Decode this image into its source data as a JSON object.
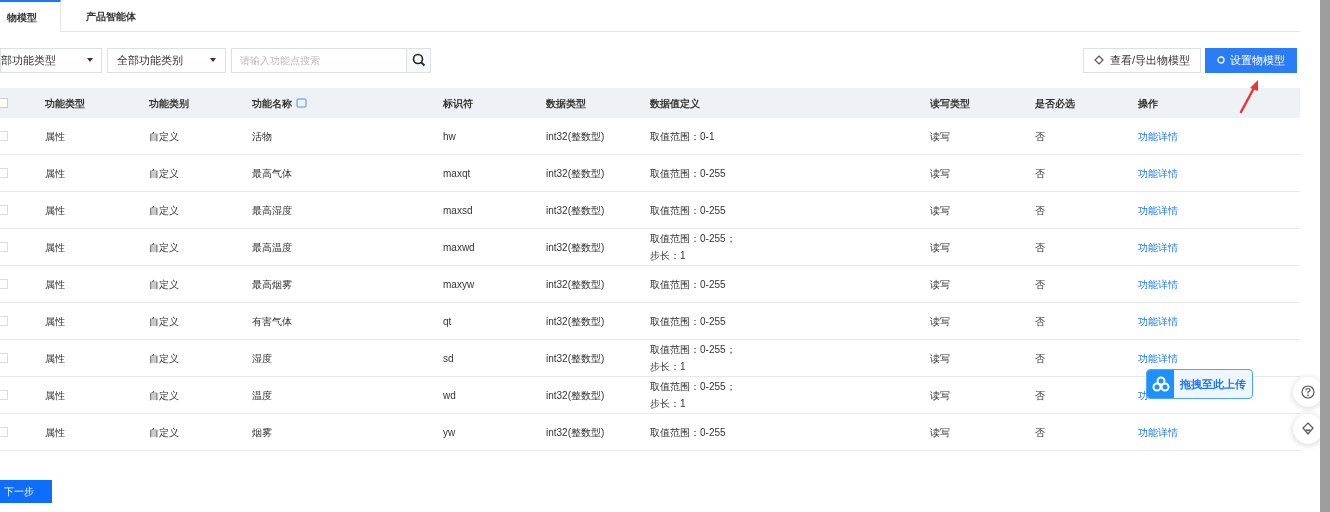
{
  "tabs": [
    {
      "label": "物模型",
      "selected": true
    },
    {
      "label": "产品智能体",
      "selected": false
    }
  ],
  "filters": {
    "type_select": "部功能类型",
    "category_select": "全部功能类别",
    "search": {
      "placeholder": "请输入功能点搜索"
    }
  },
  "buttons": {
    "export": "查看/导出物模型",
    "setup": "设置物模型"
  },
  "table": {
    "select_all_checked": false,
    "columns": [
      "功能类型",
      "功能类别",
      "功能名称",
      "标识符",
      "数据类型",
      "数据值定义",
      "读写类型",
      "是否必选",
      "操作"
    ],
    "rows": [
      {
        "checked": false,
        "cells": [
          "属性",
          "自定义",
          "活物",
          "hw",
          "int32(整数型)",
          [
            "取值范围：0-1"
          ],
          "读写",
          "否",
          "功能详情"
        ]
      },
      {
        "checked": false,
        "cells": [
          "属性",
          "自定义",
          "最高气体",
          "maxqt",
          "int32(整数型)",
          [
            "取值范围：0-255"
          ],
          "读写",
          "否",
          "功能详情"
        ]
      },
      {
        "checked": false,
        "cells": [
          "属性",
          "自定义",
          "最高湿度",
          "maxsd",
          "int32(整数型)",
          [
            "取值范围：0-255"
          ],
          "读写",
          "否",
          "功能详情"
        ]
      },
      {
        "checked": false,
        "cells": [
          "属性",
          "自定义",
          "最高温度",
          "maxwd",
          "int32(整数型)",
          [
            "取值范围：0-255；",
            "步长：1"
          ],
          "读写",
          "否",
          "功能详情"
        ]
      },
      {
        "checked": false,
        "cells": [
          "属性",
          "自定义",
          "最高烟雾",
          "maxyw",
          "int32(整数型)",
          [
            "取值范围：0-255"
          ],
          "读写",
          "否",
          "功能详情"
        ]
      },
      {
        "checked": false,
        "cells": [
          "属性",
          "自定义",
          "有害气体",
          "qt",
          "int32(整数型)",
          [
            "取值范围：0-255"
          ],
          "读写",
          "否",
          "功能详情"
        ]
      },
      {
        "checked": false,
        "cells": [
          "属性",
          "自定义",
          "湿度",
          "sd",
          "int32(整数型)",
          [
            "取值范围：0-255；",
            "步长：1"
          ],
          "读写",
          "否",
          "功能详情"
        ]
      },
      {
        "checked": false,
        "cells": [
          "属性",
          "自定义",
          "温度",
          "wd",
          "int32(整数型)",
          [
            "取值范围：0-255；",
            "步长：1"
          ],
          "读写",
          "否",
          "功"
        ]
      },
      {
        "checked": false,
        "cells": [
          "属性",
          "自定义",
          "烟雾",
          "yw",
          "int32(整数型)",
          [
            "取值范围：0-255"
          ],
          "读写",
          "否",
          "功能详情"
        ]
      }
    ]
  },
  "next_button": "下一步",
  "upload_badge": "拖拽至此上传"
}
